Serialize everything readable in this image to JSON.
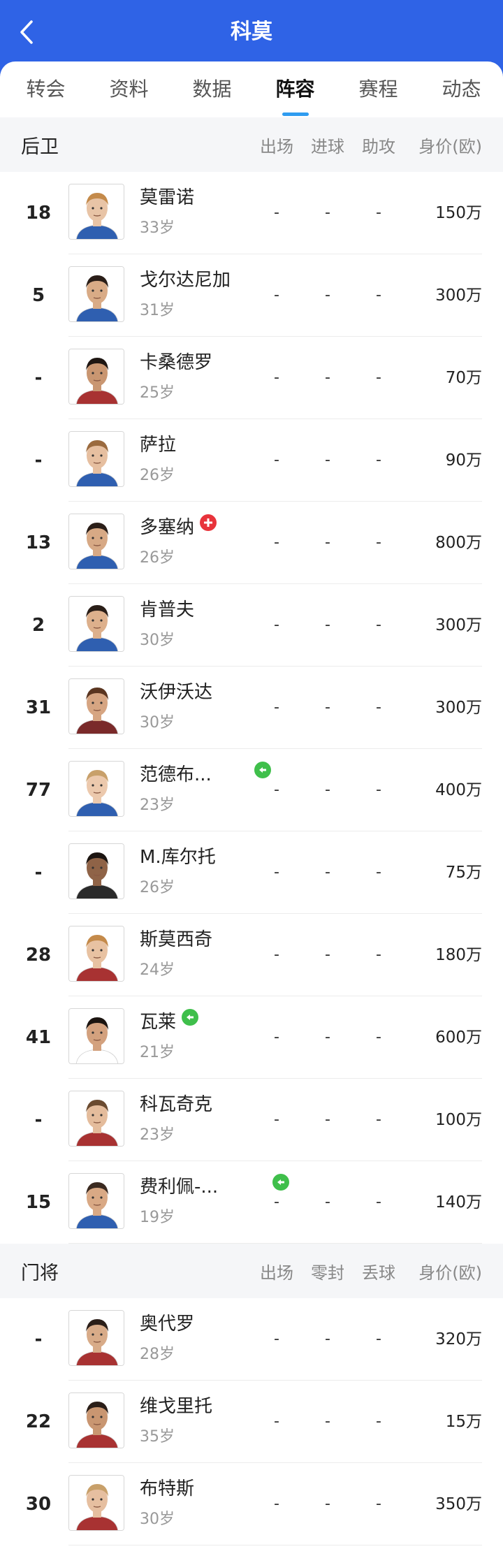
{
  "header": {
    "title": "科莫"
  },
  "tabs": [
    {
      "label": "转会"
    },
    {
      "label": "资料"
    },
    {
      "label": "数据"
    },
    {
      "label": "阵容",
      "active": true
    },
    {
      "label": "赛程"
    },
    {
      "label": "动态"
    }
  ],
  "defenders": {
    "title": "后卫",
    "columns": [
      "出场",
      "进球",
      "助攻",
      "身价(欧)"
    ],
    "players": [
      {
        "number": "18",
        "name": "莫雷诺",
        "age": "33岁",
        "apps": "-",
        "goals": "-",
        "assists": "-",
        "value": "150万",
        "kit": "#2f5fb0",
        "skin": "#e8c4a6",
        "hair": "#c48a4a"
      },
      {
        "number": "5",
        "name": "戈尔达尼加",
        "age": "31岁",
        "apps": "-",
        "goals": "-",
        "assists": "-",
        "value": "300万",
        "kit": "#2f5fb0",
        "skin": "#d9ab86",
        "hair": "#2a1e18"
      },
      {
        "number": "-",
        "name": "卡桑德罗",
        "age": "25岁",
        "apps": "-",
        "goals": "-",
        "assists": "-",
        "value": "70万",
        "kit": "#a83232",
        "skin": "#c99671",
        "hair": "#1e1612"
      },
      {
        "number": "-",
        "name": "萨拉",
        "age": "26岁",
        "apps": "-",
        "goals": "-",
        "assists": "-",
        "value": "90万",
        "kit": "#2f5fb0",
        "skin": "#e6bfa0",
        "hair": "#9a6a3e"
      },
      {
        "number": "13",
        "name": "多塞纳",
        "age": "26岁",
        "apps": "-",
        "goals": "-",
        "assists": "-",
        "value": "800万",
        "kit": "#2f5fb0",
        "skin": "#d7a985",
        "hair": "#2a1e18",
        "badge": "red"
      },
      {
        "number": "2",
        "name": "肯普夫",
        "age": "30岁",
        "apps": "-",
        "goals": "-",
        "assists": "-",
        "value": "300万",
        "kit": "#2f5fb0",
        "skin": "#ddb08c",
        "hair": "#2a1e18"
      },
      {
        "number": "31",
        "name": "沃伊沃达",
        "age": "30岁",
        "apps": "-",
        "goals": "-",
        "assists": "-",
        "value": "300万",
        "kit": "#7a2a2a",
        "skin": "#d6a582",
        "hair": "#5a3520"
      },
      {
        "number": "77",
        "name": "范德布...",
        "age": "23岁",
        "apps": "-",
        "goals": "-",
        "assists": "-",
        "value": "400万",
        "kit": "#2f5fb0",
        "skin": "#ecc9ad",
        "hair": "#c8a06a",
        "badge": "green"
      },
      {
        "number": "-",
        "name": "M.库尔托",
        "age": "26岁",
        "apps": "-",
        "goals": "-",
        "assists": "-",
        "value": "75万",
        "kit": "#2a2a2a",
        "skin": "#8f6347",
        "hair": "#1b1410"
      },
      {
        "number": "28",
        "name": "斯莫西奇",
        "age": "24岁",
        "apps": "-",
        "goals": "-",
        "assists": "-",
        "value": "180万",
        "kit": "#a83232",
        "skin": "#e8c2a2",
        "hair": "#c48a4a"
      },
      {
        "number": "41",
        "name": "瓦莱",
        "age": "21岁",
        "apps": "-",
        "goals": "-",
        "assists": "-",
        "value": "600万",
        "kit": "#ffffff",
        "skin": "#d3a17e",
        "hair": "#1b1410",
        "badge": "green"
      },
      {
        "number": "-",
        "name": "科瓦奇克",
        "age": "23岁",
        "apps": "-",
        "goals": "-",
        "assists": "-",
        "value": "100万",
        "kit": "#a83232",
        "skin": "#e4bc9c",
        "hair": "#6a4a30"
      },
      {
        "number": "15",
        "name": "费利佩-...",
        "age": "19岁",
        "apps": "-",
        "goals": "-",
        "assists": "-",
        "value": "140万",
        "kit": "#2f5fb0",
        "skin": "#d9a985",
        "hair": "#3a2a20",
        "badge": "green"
      }
    ]
  },
  "goalkeepers": {
    "title": "门将",
    "columns": [
      "出场",
      "零封",
      "丢球",
      "身价(欧)"
    ],
    "players": [
      {
        "number": "-",
        "name": "奥代罗",
        "age": "28岁",
        "apps": "-",
        "goals": "-",
        "assists": "-",
        "value": "320万",
        "kit": "#a83232",
        "skin": "#d8ab88",
        "hair": "#2a1e18"
      },
      {
        "number": "22",
        "name": "维戈里托",
        "age": "35岁",
        "apps": "-",
        "goals": "-",
        "assists": "-",
        "value": "15万",
        "kit": "#a83232",
        "skin": "#c99671",
        "hair": "#2a1e18"
      },
      {
        "number": "30",
        "name": "布特斯",
        "age": "30岁",
        "apps": "-",
        "goals": "-",
        "assists": "-",
        "value": "350万",
        "kit": "#a83232",
        "skin": "#e6bfa0",
        "hair": "#c8a06a"
      }
    ]
  }
}
